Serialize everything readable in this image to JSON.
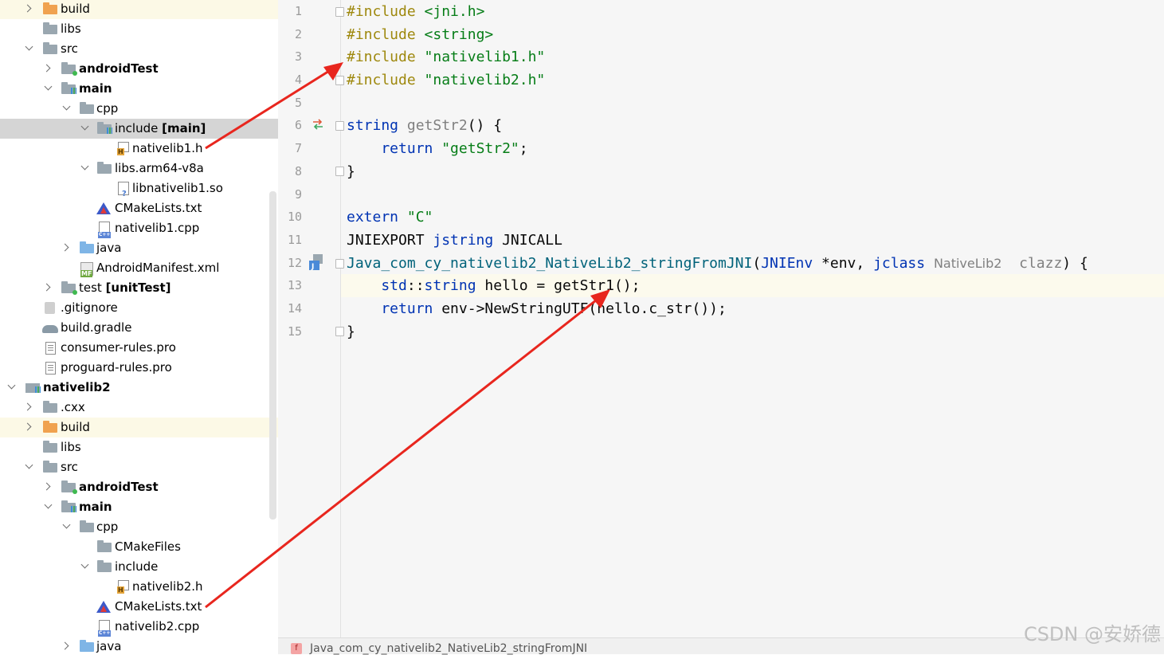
{
  "tree": {
    "items": [
      {
        "label": "build",
        "bold": ""
      },
      {
        "label": "libs",
        "bold": ""
      },
      {
        "label": "src",
        "bold": ""
      },
      {
        "label": "",
        "bold": "androidTest"
      },
      {
        "label": "",
        "bold": "main"
      },
      {
        "label": "cpp",
        "bold": ""
      },
      {
        "label": "include ",
        "bold": "[main]"
      },
      {
        "label": "nativelib1.h",
        "bold": ""
      },
      {
        "label": "libs.arm64-v8a",
        "bold": ""
      },
      {
        "label": "libnativelib1.so",
        "bold": ""
      },
      {
        "label": "CMakeLists.txt",
        "bold": ""
      },
      {
        "label": "nativelib1.cpp",
        "bold": ""
      },
      {
        "label": "java",
        "bold": ""
      },
      {
        "label": "AndroidManifest.xml",
        "bold": ""
      },
      {
        "label": "test ",
        "bold": "[unitTest]"
      },
      {
        "label": ".gitignore",
        "bold": ""
      },
      {
        "label": "build.gradle",
        "bold": ""
      },
      {
        "label": "consumer-rules.pro",
        "bold": ""
      },
      {
        "label": "proguard-rules.pro",
        "bold": ""
      },
      {
        "label": "",
        "bold": "nativelib2"
      },
      {
        "label": ".cxx",
        "bold": ""
      },
      {
        "label": "build",
        "bold": ""
      },
      {
        "label": "libs",
        "bold": ""
      },
      {
        "label": "src",
        "bold": ""
      },
      {
        "label": "",
        "bold": "androidTest"
      },
      {
        "label": "",
        "bold": "main"
      },
      {
        "label": "cpp",
        "bold": ""
      },
      {
        "label": "CMakeFiles",
        "bold": ""
      },
      {
        "label": "include",
        "bold": ""
      },
      {
        "label": "nativelib2.h",
        "bold": ""
      },
      {
        "label": "CMakeLists.txt",
        "bold": ""
      },
      {
        "label": "nativelib2.cpp",
        "bold": ""
      },
      {
        "label": "java",
        "bold": ""
      }
    ]
  },
  "editor": {
    "line_numbers": [
      "1",
      "2",
      "3",
      "4",
      "5",
      "6",
      "7",
      "8",
      "9",
      "10",
      "11",
      "12",
      "13",
      "14",
      "15"
    ],
    "lines": [
      [
        {
          "t": "#include ",
          "c": "pp"
        },
        {
          "t": "<jni.h>",
          "c": "ppstr"
        }
      ],
      [
        {
          "t": "#include ",
          "c": "pp"
        },
        {
          "t": "<string>",
          "c": "ppstr"
        }
      ],
      [
        {
          "t": "#include ",
          "c": "pp"
        },
        {
          "t": "\"nativelib1.h\"",
          "c": "ppstr"
        }
      ],
      [
        {
          "t": "#include ",
          "c": "pp"
        },
        {
          "t": "\"nativelib2.h\"",
          "c": "ppstr"
        }
      ],
      [],
      [
        {
          "t": "string ",
          "c": "kw"
        },
        {
          "t": "getStr2",
          "c": "gray"
        },
        {
          "t": "() {",
          "c": ""
        }
      ],
      [
        {
          "t": "    return ",
          "c": "kw"
        },
        {
          "t": "\"getStr2\"",
          "c": "str"
        },
        {
          "t": ";",
          "c": ""
        }
      ],
      [
        {
          "t": "}",
          "c": ""
        }
      ],
      [],
      [
        {
          "t": "extern ",
          "c": "kw"
        },
        {
          "t": "\"C\"",
          "c": "str"
        }
      ],
      [
        {
          "t": "JNIEXPORT ",
          "c": ""
        },
        {
          "t": "jstring ",
          "c": "kw"
        },
        {
          "t": "JNICALL",
          "c": ""
        }
      ],
      [
        {
          "t": "Java_com_cy_nativelib2_NativeLib2_stringFromJNI",
          "c": "fn"
        },
        {
          "t": "(",
          "c": ""
        },
        {
          "t": "JNIEnv ",
          "c": "kw"
        },
        {
          "t": "*env, ",
          "c": ""
        },
        {
          "t": "jclass ",
          "c": "kw"
        },
        {
          "t": "NativeLib2",
          "c": "hint"
        },
        {
          "t": "  clazz",
          "c": "gray"
        },
        {
          "t": ") {",
          "c": ""
        }
      ],
      [
        {
          "t": "    std",
          "c": "kw"
        },
        {
          "t": "::",
          "c": ""
        },
        {
          "t": "string ",
          "c": "kw"
        },
        {
          "t": "hello = getStr1();",
          "c": ""
        }
      ],
      [
        {
          "t": "    return ",
          "c": "kw"
        },
        {
          "t": "env->NewStringUTF(hello.c_str());",
          "c": ""
        }
      ],
      [
        {
          "t": "}",
          "c": ""
        }
      ]
    ],
    "breadcrumb_icon": "f",
    "breadcrumb": "Java_com_cy_nativelib2_NativeLib2_stringFromJNI",
    "watermark": "CSDN @安娇德"
  }
}
